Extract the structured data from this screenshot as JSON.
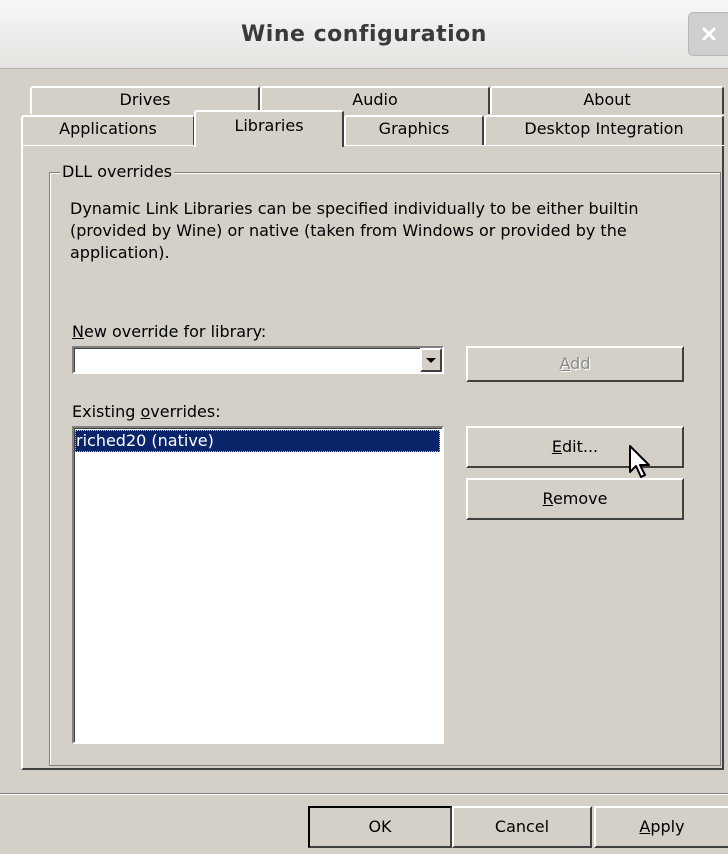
{
  "window": {
    "title": "Wine configuration",
    "close_glyph": "×"
  },
  "tabs": {
    "row_back": [
      "Drives",
      "Audio",
      "About"
    ],
    "row_front": [
      "Applications",
      "Libraries",
      "Graphics",
      "Desktop Integration"
    ],
    "active": "Libraries"
  },
  "dll_overrides": {
    "group_label": "DLL overrides",
    "description": "Dynamic Link Libraries can be specified individually to be either builtin (provided by Wine) or native (taken from Windows or provided by the application).",
    "new_override_label": "New override for library:",
    "new_override_value": "",
    "add_button": "Add",
    "existing_label_pre": "Existing ",
    "existing_label_underlined": "o",
    "existing_label_post": "verrides:",
    "existing_items": [
      "riched20 (native)"
    ],
    "edit_button": "Edit...",
    "remove_button": "Remove"
  },
  "footer": {
    "ok_button": "OK",
    "cancel_button": "Cancel",
    "apply_button": "Apply"
  },
  "colors": {
    "face": "#d4d0c8",
    "selection": "#0a246a"
  }
}
